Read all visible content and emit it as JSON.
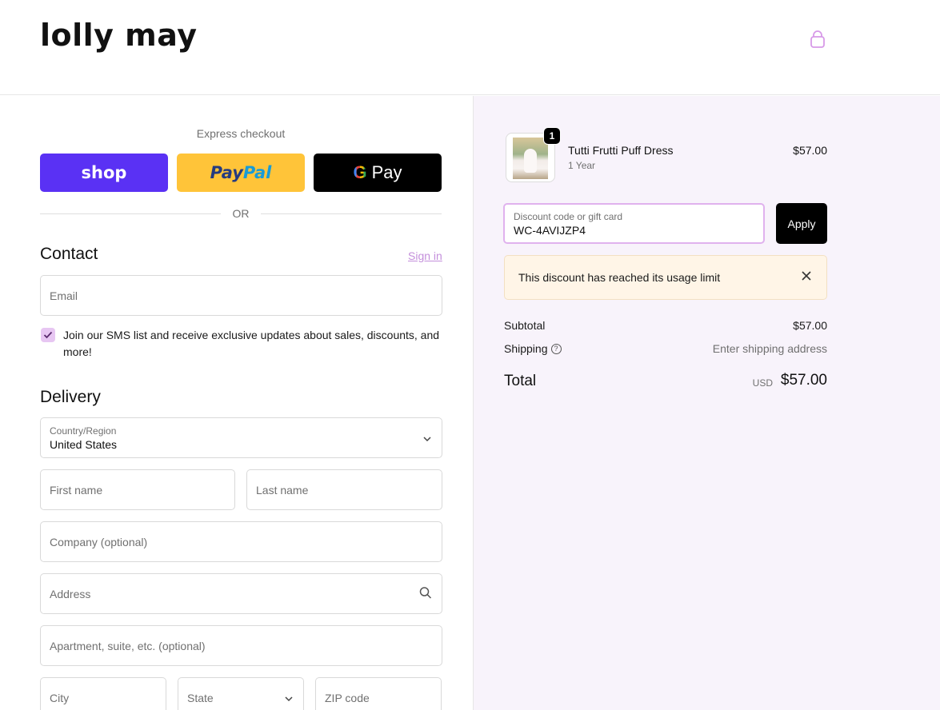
{
  "header": {
    "logo_text": "lolly may",
    "cart_icon": "shopping-bag-icon"
  },
  "express": {
    "label": "Express checkout",
    "shop_label": "shop",
    "paypal_label_1": "Pay",
    "paypal_label_2": "Pal",
    "gpay_g": "G",
    "gpay_label": "Pay",
    "or_label": "OR"
  },
  "contact": {
    "title": "Contact",
    "signin_label": "Sign in",
    "email_placeholder": "Email",
    "sms_checked": true,
    "sms_label": "Join our SMS list and receive exclusive updates about sales, discounts, and more!"
  },
  "delivery": {
    "title": "Delivery",
    "country_label": "Country/Region",
    "country_value": "United States",
    "first_name_placeholder": "First name",
    "last_name_placeholder": "Last name",
    "company_placeholder": "Company (optional)",
    "address_placeholder": "Address",
    "apartment_placeholder": "Apartment, suite, etc. (optional)",
    "city_placeholder": "City",
    "state_placeholder": "State",
    "zip_placeholder": "ZIP code"
  },
  "order": {
    "item": {
      "quantity": "1",
      "name": "Tutti Frutti Puff Dress",
      "variant": "1 Year",
      "price": "$57.00"
    },
    "discount": {
      "label": "Discount code or gift card",
      "value": "WC-4AVIJZP4",
      "apply_label": "Apply"
    },
    "alert": {
      "message": "This discount has reached its usage limit",
      "close_icon": "close-icon"
    },
    "summary": {
      "subtotal_label": "Subtotal",
      "subtotal_value": "$57.00",
      "shipping_label": "Shipping",
      "shipping_value": "Enter shipping address",
      "total_label": "Total",
      "currency": "USD",
      "total_value": "$57.00"
    }
  },
  "colors": {
    "accent": "#c48fdb",
    "shop_purple": "#5a31f4",
    "paypal_yellow": "#ffc439",
    "aside_bg": "#f8f3fb"
  }
}
